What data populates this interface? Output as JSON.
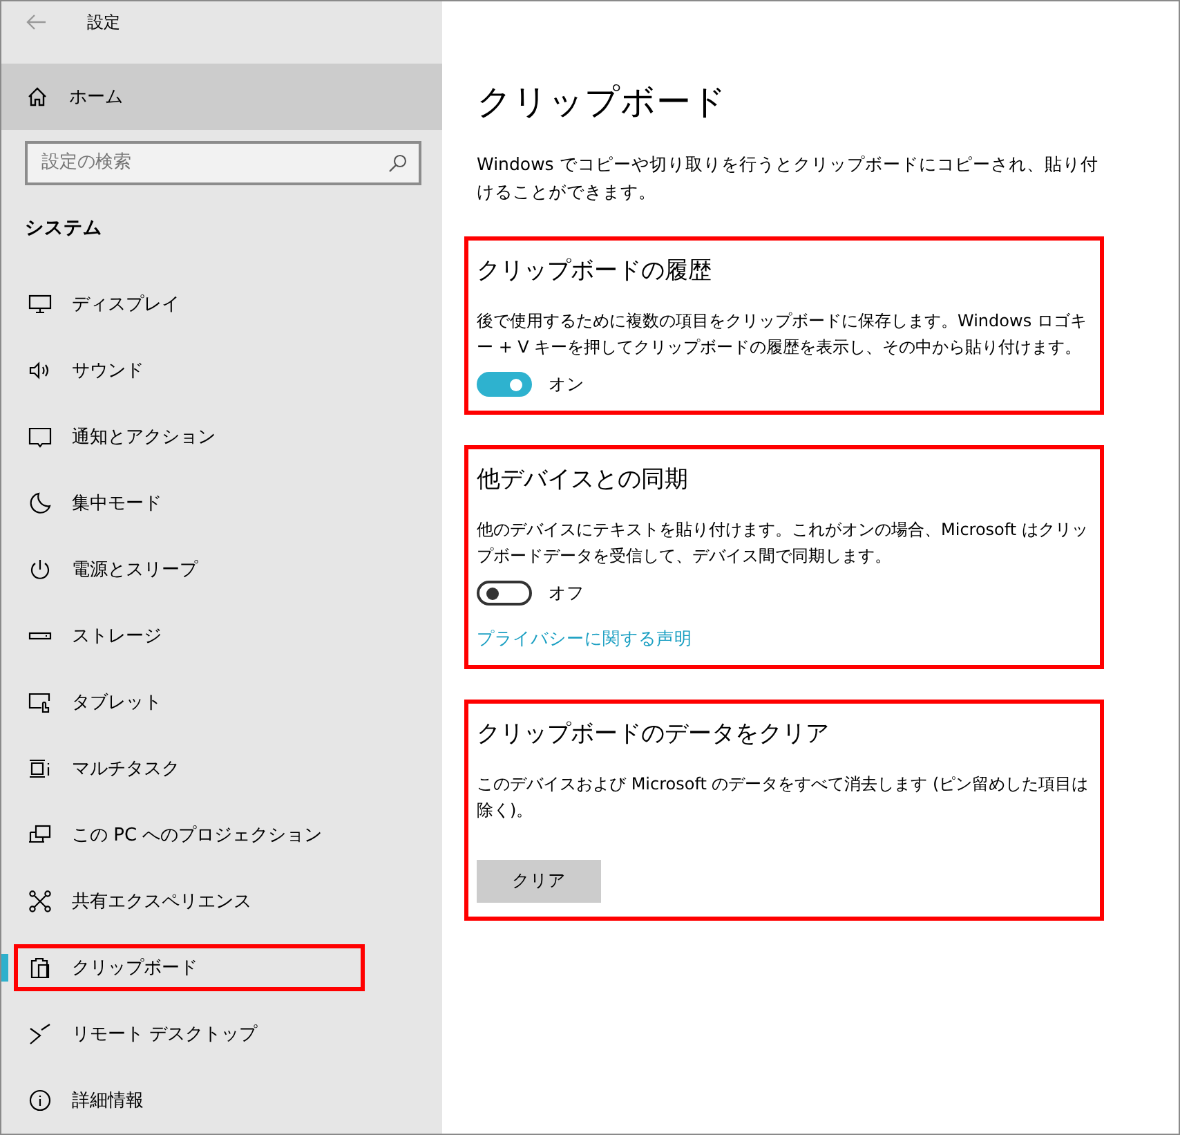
{
  "window": {
    "title": "設定"
  },
  "sidebar": {
    "home": "ホーム",
    "search": {
      "placeholder": "設定の検索"
    },
    "heading": "システム",
    "items": [
      {
        "label": "ディスプレイ",
        "selected": false,
        "highlighted": false
      },
      {
        "label": "サウンド",
        "selected": false,
        "highlighted": false
      },
      {
        "label": "通知とアクション",
        "selected": false,
        "highlighted": false
      },
      {
        "label": "集中モード",
        "selected": false,
        "highlighted": false
      },
      {
        "label": "電源とスリープ",
        "selected": false,
        "highlighted": false
      },
      {
        "label": "ストレージ",
        "selected": false,
        "highlighted": false
      },
      {
        "label": "タブレット",
        "selected": false,
        "highlighted": false
      },
      {
        "label": "マルチタスク",
        "selected": false,
        "highlighted": false
      },
      {
        "label": "この PC へのプロジェクション",
        "selected": false,
        "highlighted": false
      },
      {
        "label": "共有エクスペリエンス",
        "selected": false,
        "highlighted": false
      },
      {
        "label": "クリップボード",
        "selected": true,
        "highlighted": true
      },
      {
        "label": "リモート デスクトップ",
        "selected": false,
        "highlighted": false
      },
      {
        "label": "詳細情報",
        "selected": false,
        "highlighted": false
      }
    ]
  },
  "main": {
    "title": "クリップボード",
    "intro": "Windows でコピーや切り取りを行うとクリップボードにコピーされ、貼り付けることができます。",
    "sections": [
      {
        "kind": "toggle",
        "highlighted": true,
        "title": "クリップボードの履歴",
        "description": "後で使用するために複数の項目をクリップボードに保存します。Windows ロゴキー + V キーを押してクリップボードの履歴を表示し、その中から貼り付けます。",
        "toggle": {
          "on": true,
          "label": "オン"
        }
      },
      {
        "kind": "toggle",
        "highlighted": true,
        "title": "他デバイスとの同期",
        "description": "他のデバイスにテキストを貼り付けます。これがオンの場合、Microsoft はクリップボードデータを受信して、デバイス間で同期します。",
        "toggle": {
          "on": false,
          "label": "オフ"
        },
        "link": "プライバシーに関する声明"
      },
      {
        "kind": "button",
        "highlighted": true,
        "title": "クリップボードのデータをクリア",
        "description": "このデバイスおよび Microsoft のデータをすべて消去します (ピン留めした項目は除く)。",
        "button": "クリア"
      }
    ]
  }
}
